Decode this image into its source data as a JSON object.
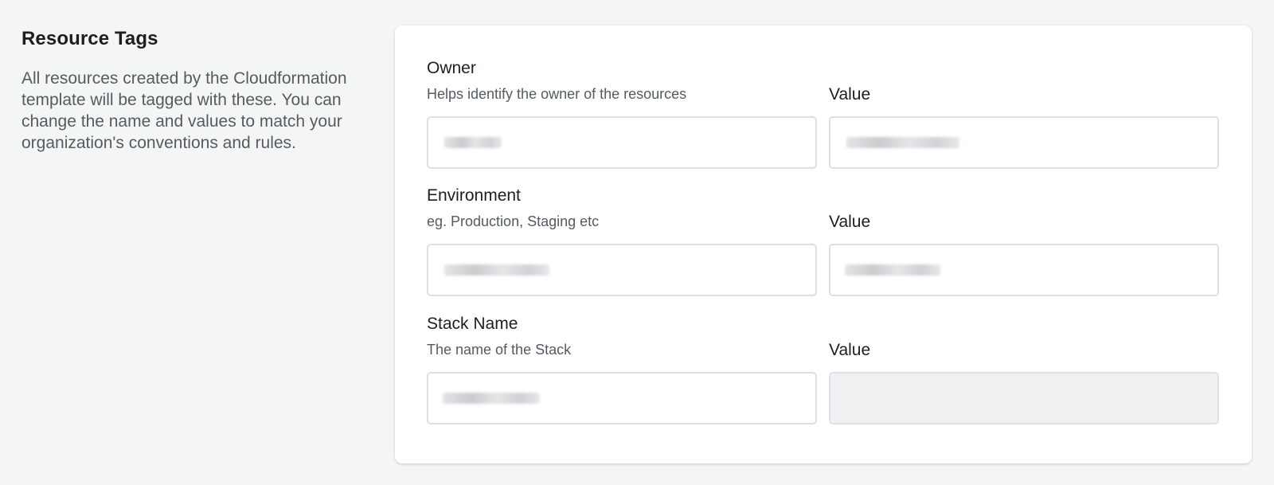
{
  "section": {
    "title": "Resource Tags",
    "description": "All resources created by the Cloudformation template will be tagged with these. You can change the name and values to match your organization's conventions and rules."
  },
  "tags": [
    {
      "label": "Owner",
      "help": "Helps identify the owner of the resources",
      "value_label": "Value",
      "name_value": "",
      "tag_value": "",
      "value_disabled": false
    },
    {
      "label": "Environment",
      "help": "eg. Production, Staging etc",
      "value_label": "Value",
      "name_value": "",
      "tag_value": "",
      "value_disabled": false
    },
    {
      "label": "Stack Name",
      "help": "The name of the Stack",
      "value_label": "Value",
      "name_value": "",
      "tag_value": "",
      "value_disabled": true
    }
  ]
}
